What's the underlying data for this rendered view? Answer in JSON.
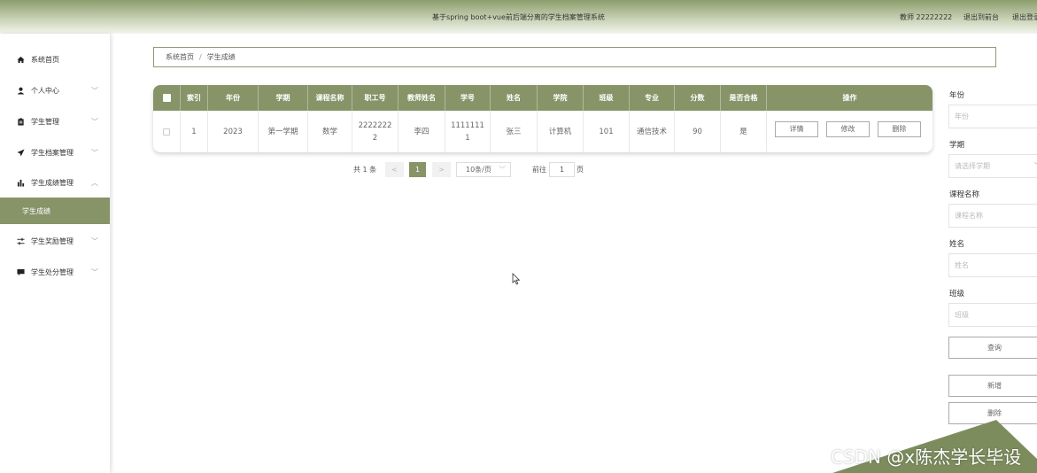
{
  "header": {
    "title": "基于spring boot+vue前后端分离的学生档案管理系统",
    "user": "教师 22222222",
    "back_label": "退出到前台",
    "logout_label": "退出登录"
  },
  "sidebar": {
    "items": [
      {
        "label": "系统首页",
        "icon": "home-icon"
      },
      {
        "label": "个人中心",
        "icon": "user-icon"
      },
      {
        "label": "学生管理",
        "icon": "clipboard-icon"
      },
      {
        "label": "学生档案管理",
        "icon": "send-icon"
      },
      {
        "label": "学生成绩管理",
        "icon": "bar-chart-icon"
      },
      {
        "label": "学生成绩",
        "icon": ""
      },
      {
        "label": "学生奖励管理",
        "icon": "sliders-icon"
      },
      {
        "label": "学生处分管理",
        "icon": "message-icon"
      }
    ]
  },
  "breadcrumb": {
    "home": "系统首页",
    "separator": "/",
    "current": "学生成绩"
  },
  "table": {
    "columns": [
      "索引",
      "年份",
      "学期",
      "课程名称",
      "职工号",
      "教师姓名",
      "学号",
      "姓名",
      "学院",
      "班级",
      "专业",
      "分数",
      "是否合格",
      "操作"
    ],
    "rows": [
      {
        "index": "1",
        "year": "2023",
        "term": "第一学期",
        "course": "数学",
        "staff_no_1": "2222222",
        "staff_no_2": "2",
        "teacher": "李四",
        "student_no_1": "1111111",
        "student_no_2": "1",
        "name": "张三",
        "college": "计算机",
        "class": "101",
        "major": "通信技术",
        "score": "90",
        "passed": "是",
        "actions": {
          "detail": "详情",
          "edit": "修改",
          "delete": "删除"
        }
      }
    ]
  },
  "pagination": {
    "total": "共 1 条",
    "prev": "<",
    "current_page": "1",
    "next": ">",
    "page_size": "10条/页",
    "goto_label": "前往",
    "goto_value": "1",
    "page_suffix": "页"
  },
  "search": {
    "year_label": "年份",
    "year_placeholder": "年份",
    "term_label": "学期",
    "term_placeholder": "请选择学期",
    "course_label": "课程名称",
    "course_placeholder": "课程名称",
    "name_label": "姓名",
    "name_placeholder": "姓名",
    "class_label": "班级",
    "class_placeholder": "班级",
    "query_label": "查询",
    "add_label": "新增",
    "delete_label": "删除"
  },
  "watermark": "CSDN @x陈杰学长毕设",
  "colors": {
    "accent": "#869468",
    "accent_dark": "#6f7d55",
    "decoration": "#7d8c5d"
  }
}
